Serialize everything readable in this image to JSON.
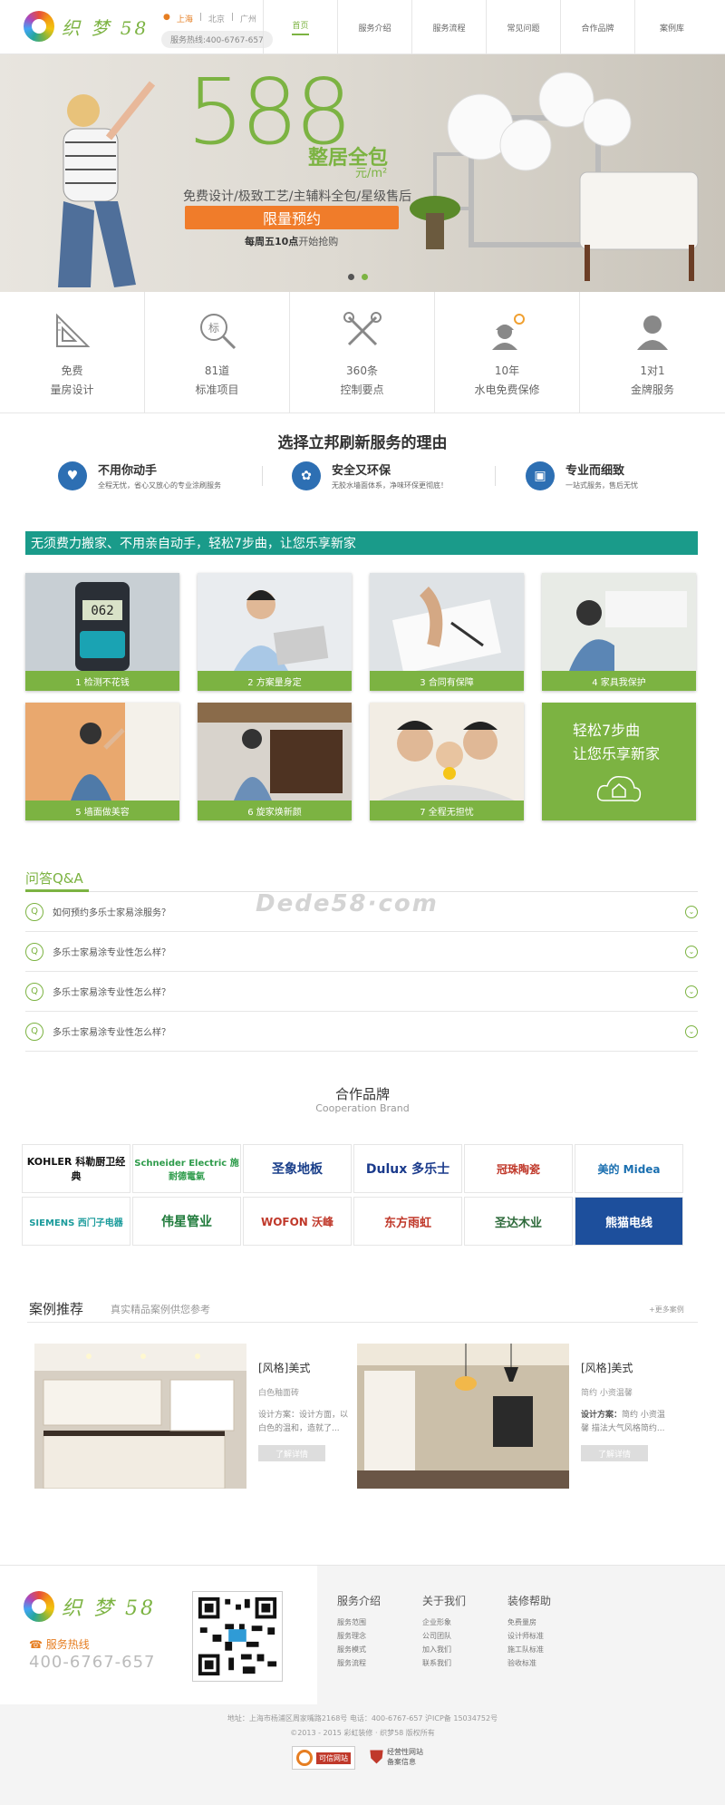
{
  "header": {
    "logo_text": "织 梦 58",
    "cities": [
      "上海",
      "北京",
      "广州"
    ],
    "hotline": "服务热线:400-6767-657",
    "nav": [
      "首页",
      "服务介绍",
      "服务流程",
      "常见问题",
      "合作品牌",
      "案例库"
    ]
  },
  "banner": {
    "big_number": "588",
    "package": "整居全包",
    "unit": "元/m²",
    "subtitle": "免费设计/极致工艺/主辅料全包/星级售后",
    "cta": "限量预约",
    "note_bold": "每周五10点",
    "note_rest": "开始抢购"
  },
  "features": [
    {
      "icon": "set-square-icon",
      "l1": "免费",
      "l2": "量房设计"
    },
    {
      "icon": "standard-magnifier-icon",
      "l1": "81道",
      "l2": "标准项目"
    },
    {
      "icon": "tools-icon",
      "l1": "360条",
      "l2": "控制要点"
    },
    {
      "icon": "worker-icon",
      "l1": "10年",
      "l2": "水电免费保修"
    },
    {
      "icon": "service-agent-icon",
      "l1": "1对1",
      "l2": "金牌服务"
    }
  ],
  "reasons": {
    "title": "选择立邦刷新服务的理由",
    "items": [
      {
        "h": "不用你动手",
        "d": "全程无忧，省心又放心的专业涂刷服务"
      },
      {
        "h": "安全又环保",
        "d": "无胶水墙面体系，净味环保更彻底！"
      },
      {
        "h": "专业而细致",
        "d": "一站式服务，售后无忧"
      }
    ]
  },
  "steps": {
    "band": "无须费力搬家、不用亲自动手，轻松7步曲，让您乐享新家",
    "items": [
      "1 检测不花钱",
      "2 方案量身定",
      "3 合同有保障",
      "4 家具我保护",
      "5 墙面做美容",
      "6 旋家焕新颜",
      "7 全程无担忧"
    ],
    "final_line1": "轻松7步曲",
    "final_line2": "让您乐享新家"
  },
  "qa": {
    "title": "问答Q&A",
    "watermark": "Dede58·com",
    "questions": [
      "如何预约多乐士家易涂服务？",
      "多乐士家易涂专业性怎么样？",
      "多乐士家易涂专业性怎么样？",
      "多乐士家易涂专业性怎么样？"
    ]
  },
  "brands": {
    "title": "合作品牌",
    "subtitle": "Cooperation Brand",
    "items": [
      "KOHLER 科勒厨卫经典",
      "Schneider Electric 施耐德電氣",
      "圣象地板",
      "Dulux 多乐士",
      "冠珠陶瓷",
      "美的 Midea",
      "SIEMENS 西门子电器",
      "伟星管业",
      "WOFON 沃峰",
      "东方雨虹",
      "圣达木业",
      "熊猫电线"
    ]
  },
  "cases": {
    "title": "案例推荐",
    "subtitle": "真实精品案例供您参考",
    "more": "+更多案例",
    "items": [
      {
        "style": "[风格]美式",
        "tag": "白色釉面砖",
        "desc_label": "设计方案：",
        "desc": "设计方案：设计方面，以白色的温和，造就了...",
        "btn": "了解详情"
      },
      {
        "style": "[风格]美式",
        "tag": "简约 小资温馨",
        "desc_label": "设计方案：",
        "desc": "简约 小资温馨 描法大气风格简约...",
        "btn": "了解详情"
      }
    ]
  },
  "footer": {
    "logo_text": "织 梦 58",
    "hotline_label": "服务热线",
    "hotline_number": "400-6767-657",
    "columns": [
      {
        "h": "服务介绍",
        "items": [
          "服务范围",
          "服务理念",
          "服务模式",
          "服务流程"
        ]
      },
      {
        "h": "关于我们",
        "items": [
          "企业形象",
          "公司团队",
          "加入我们",
          "联系我们"
        ]
      },
      {
        "h": "装修帮助",
        "items": [
          "免费量房",
          "设计师标准",
          "施工队标准",
          "验收标准"
        ]
      }
    ],
    "address": "地址：上海市杨浦区周家嘴路2168号  电话：400-6767-657  沪ICP备 15034752号",
    "copyright": "©2013 - 2015 彩虹装修 · 织梦58 版权所有",
    "badge1": "可信网站",
    "badge2_l1": "经营性网站",
    "badge2_l2": "备案信息"
  }
}
